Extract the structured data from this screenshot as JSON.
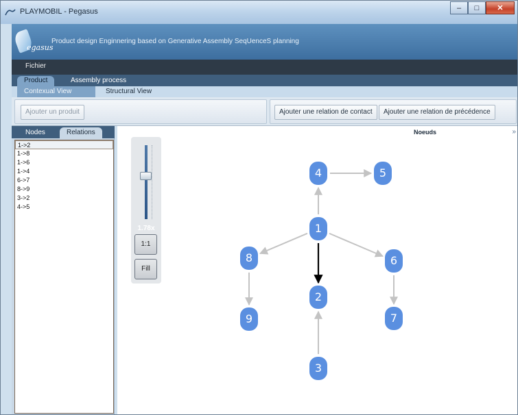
{
  "window": {
    "title": "PLAYMOBIL - Pegasus",
    "app_icon": "pegasus-app-icon",
    "controls": [
      "minimize-icon",
      "maximize-icon",
      "close-icon"
    ]
  },
  "banner": {
    "logo_text": "egasus",
    "subtitle": "Product design Enginnering based on Generative Assembly SeqUenceS planning"
  },
  "menu": {
    "items": [
      "Fichier"
    ]
  },
  "tabs_main": [
    "Product",
    "Assembly process"
  ],
  "tabs_sub": [
    "Contexual View",
    "Structural View"
  ],
  "toolbar": {
    "add_product": "Ajouter un produit",
    "add_contact": "Ajouter une relation de contact",
    "add_precedence": "Ajouter une relation de précédence"
  },
  "left_panel": {
    "tabs": [
      "Nodes",
      "Relations"
    ],
    "active_tab": "Relations",
    "relations": [
      "1->2",
      "1->8",
      "1->6",
      "1->4",
      "6->7",
      "8->9",
      "3->2",
      "4->5"
    ]
  },
  "graph": {
    "header": "Noeuds",
    "zoom_level": "1.78x",
    "zoom_buttons": [
      "1:1",
      "Fill"
    ],
    "nodes": [
      "1",
      "2",
      "3",
      "4",
      "5",
      "6",
      "7",
      "8",
      "9"
    ],
    "edges": [
      {
        "from": "1",
        "to": "2",
        "highlighted": true
      },
      {
        "from": "1",
        "to": "8",
        "highlighted": false
      },
      {
        "from": "1",
        "to": "6",
        "highlighted": false
      },
      {
        "from": "1",
        "to": "4",
        "highlighted": false
      },
      {
        "from": "6",
        "to": "7",
        "highlighted": false
      },
      {
        "from": "8",
        "to": "9",
        "highlighted": false
      },
      {
        "from": "3",
        "to": "2",
        "highlighted": false
      },
      {
        "from": "4",
        "to": "5",
        "highlighted": false
      }
    ],
    "colors": {
      "node": "#5a8fe0",
      "edge": "#c3c3c3",
      "edge_highlight": "#000000"
    }
  }
}
